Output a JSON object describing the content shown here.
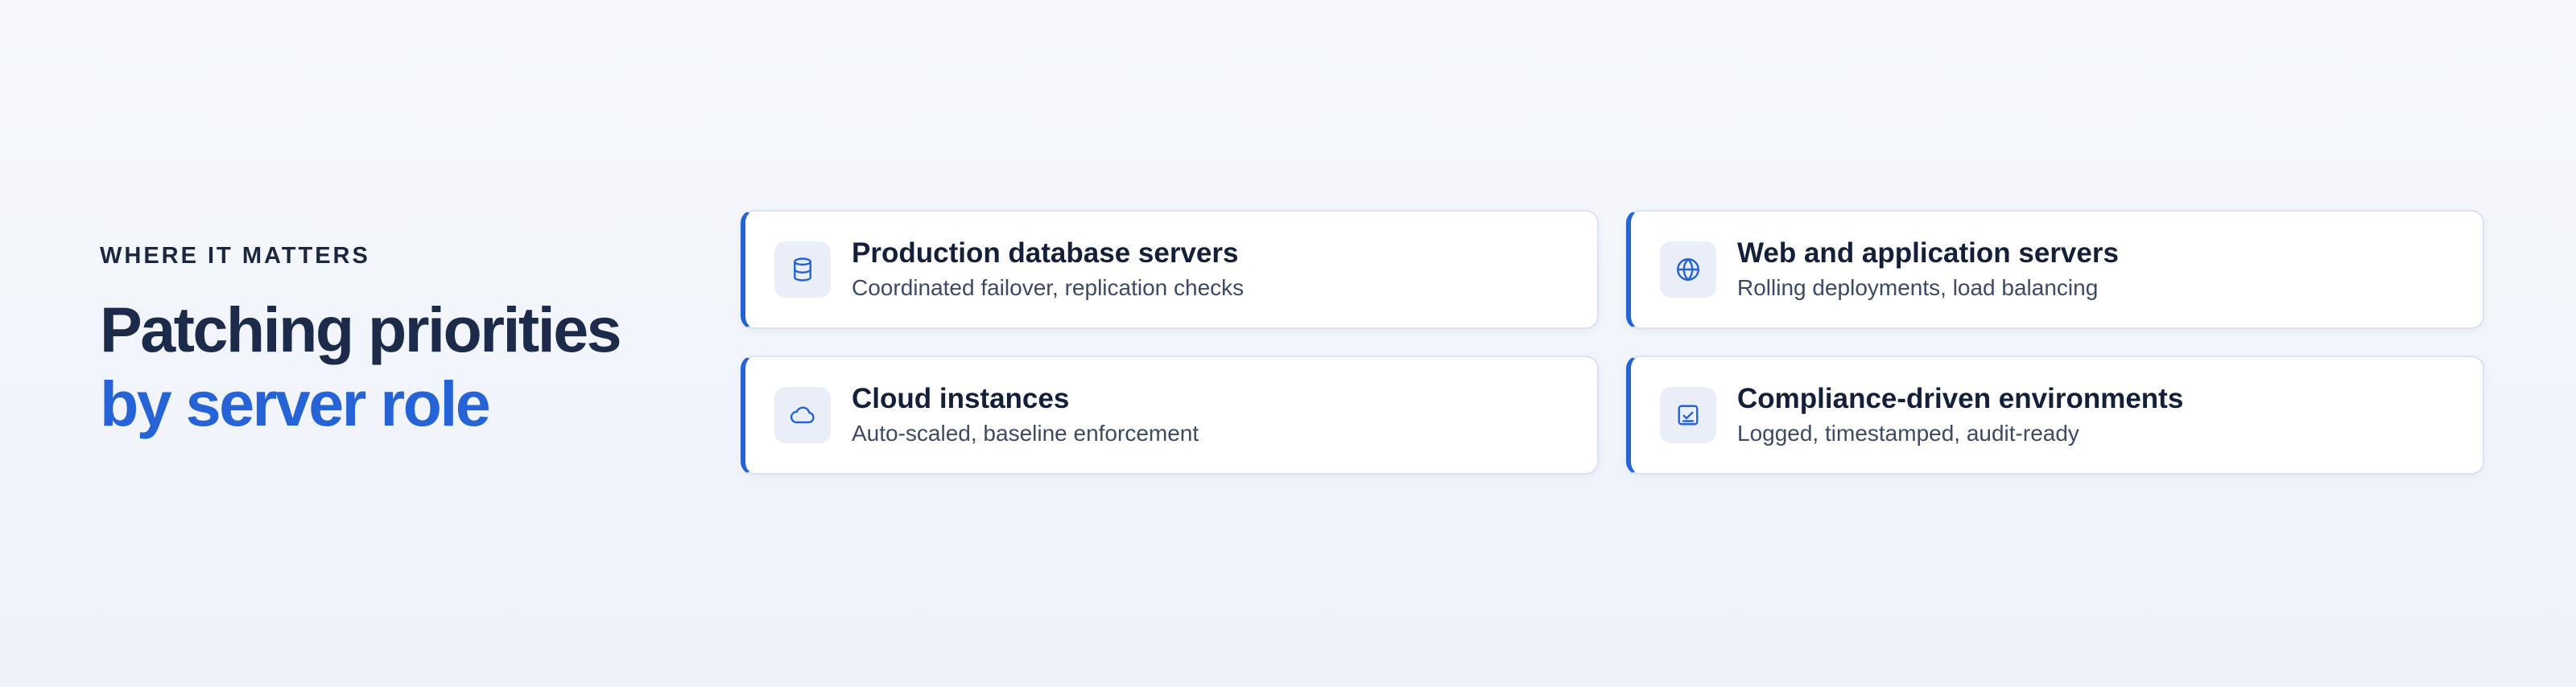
{
  "hero": {
    "eyebrow": "WHERE IT MATTERS",
    "headline_line1": "Patching priorities",
    "headline_line2": "by server role"
  },
  "colors": {
    "accent": "#2563d6",
    "heading": "#1d2b4b",
    "background": "#f2f5fb"
  },
  "cards": [
    {
      "icon": "database-icon",
      "title": "Production database servers",
      "description": "Coordinated failover, replication checks"
    },
    {
      "icon": "globe-icon",
      "title": "Web and application servers",
      "description": "Rolling deployments, load balancing"
    },
    {
      "icon": "cloud-icon",
      "title": "Cloud instances",
      "description": "Auto-scaled, baseline enforcement"
    },
    {
      "icon": "checklist-icon",
      "title": "Compliance-driven environments",
      "description": "Logged, timestamped, audit-ready"
    }
  ]
}
